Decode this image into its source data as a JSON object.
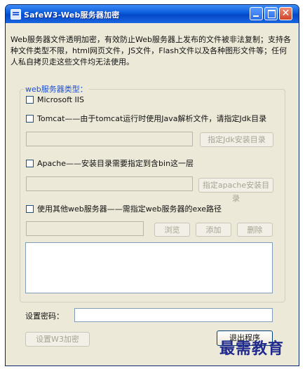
{
  "window": {
    "title": "SafeW3-Web服务器加密",
    "controls": {
      "minimize": "minimize-icon",
      "maximize": "maximize-icon",
      "close": "close-icon",
      "close_glyph": "✕"
    }
  },
  "description": "Web服务器文件透明加密，有效防止Web服务器上发布的文件被非法复制；支持各种文件类型不限，html网页文件，JS文件，Flash文件以及各种图形文件等；任何人私自拷贝走这些文件均无法使用。",
  "server_group": {
    "title": "web服务器类型：",
    "iis": {
      "label": "Microsoft IIS",
      "checked": false
    },
    "tomcat": {
      "label": "Tomcat——由于tomcat运行时使用Java解析文件，请指定Jdk目录",
      "checked": false,
      "path_value": "",
      "button": "指定Jdk安装目录"
    },
    "apache": {
      "label": "Apache——安装目录需要指定到含bin这一层",
      "checked": false,
      "path_value": "",
      "button": "指定apache安装目录"
    },
    "other": {
      "label": "使用其他web服务器——需指定web服务器的exe路径",
      "checked": false,
      "path_value": "",
      "browse": "浏览",
      "add": "添加",
      "delete": "删除",
      "list": []
    }
  },
  "password": {
    "label": "设置密码：",
    "value": ""
  },
  "buttons": {
    "set_encrypt": "设置W3加密",
    "exit": "退出程序"
  },
  "watermark": "最需教育"
}
